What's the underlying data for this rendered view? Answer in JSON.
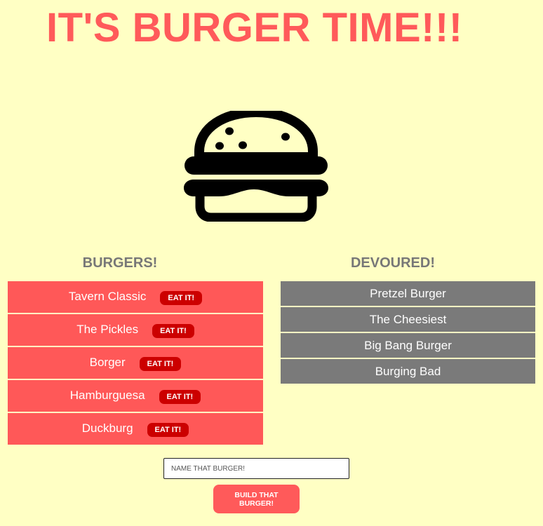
{
  "header": {
    "title": "IT'S BURGER TIME!!!"
  },
  "logo": {
    "icon": "burger-icon"
  },
  "burgers": {
    "heading": "BURGERS!",
    "eat_label": "EAT IT!",
    "items": [
      {
        "name": "Tavern Classic"
      },
      {
        "name": "The Pickles"
      },
      {
        "name": "Borger"
      },
      {
        "name": "Hamburguesa"
      },
      {
        "name": "Duckburg"
      }
    ]
  },
  "devoured": {
    "heading": "DEVOURED!",
    "items": [
      {
        "name": "Pretzel Burger"
      },
      {
        "name": "The Cheesiest"
      },
      {
        "name": "Big Bang Burger"
      },
      {
        "name": "Burging Bad"
      }
    ]
  },
  "form": {
    "placeholder": "NAME THAT BURGER!",
    "value": "",
    "submit_label": "BUILD THAT BURGER!"
  },
  "colors": {
    "background": "#ffffc4",
    "title": "#ff5a5a",
    "burger_item": "#ff5858",
    "eat_button": "#cc0000",
    "devoured_item": "#7a7a7a",
    "heading": "#777777"
  }
}
